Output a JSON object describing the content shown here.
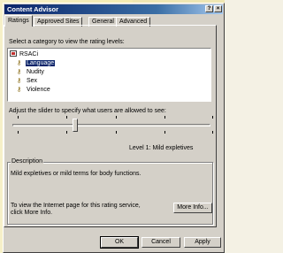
{
  "window": {
    "title": "Content Advisor",
    "help_button": "?",
    "close_button": "×"
  },
  "tabs": [
    {
      "label": "Ratings",
      "active": true
    },
    {
      "label": "Approved Sites",
      "active": false
    },
    {
      "label": "General",
      "active": false
    },
    {
      "label": "Advanced",
      "active": false
    }
  ],
  "ratings": {
    "category_prompt": "Select a category to view the rating levels:",
    "tree": {
      "root": "RSACi",
      "items": [
        "Language",
        "Nudity",
        "Sex",
        "Violence"
      ],
      "selected": "Language"
    },
    "slider_prompt": "Adjust the slider to specify what users are allowed to see:",
    "slider_level": 1,
    "slider_max_level": 4,
    "level_text": "Level 1:   Mild expletives",
    "description": {
      "legend": "Description",
      "text": "Mild expletives or mild terms for body functions.",
      "more_info_text_line1": "To view the Internet page for this rating service,",
      "more_info_text_line2": "click More Info.",
      "more_info_button": "More Info..."
    }
  },
  "footer": {
    "ok": "OK",
    "cancel": "Cancel",
    "apply": "Apply"
  }
}
